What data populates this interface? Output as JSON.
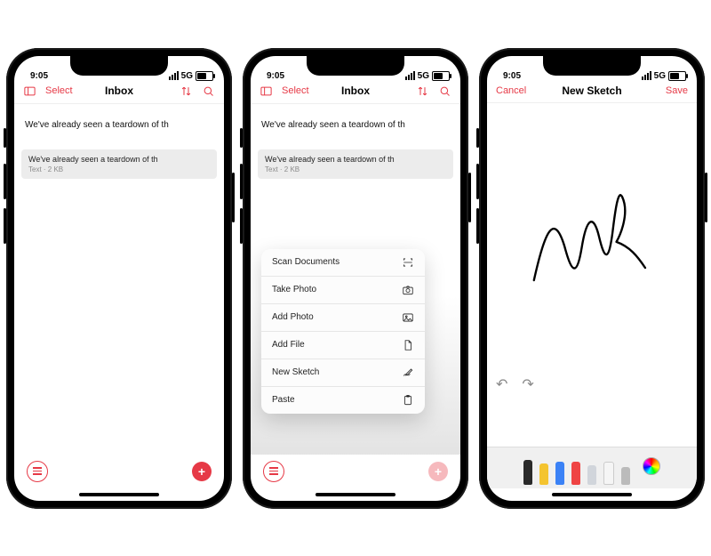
{
  "status": {
    "time": "9:05",
    "network": "5G",
    "battery_pct": 62
  },
  "phone1": {
    "nav": {
      "select": "Select",
      "title": "Inbox"
    },
    "note_preview": "We've already seen a teardown of th",
    "row": {
      "title": "We've already seen a teardown of th",
      "subtitle": "Text · 2 KB"
    }
  },
  "phone2": {
    "nav": {
      "select": "Select",
      "title": "Inbox"
    },
    "note_preview": "We've already seen a teardown of th",
    "row": {
      "title": "We've already seen a teardown of th",
      "subtitle": "Text · 2 KB"
    },
    "menu": [
      {
        "label": "Scan Documents",
        "icon": "scan"
      },
      {
        "label": "Take Photo",
        "icon": "camera"
      },
      {
        "label": "Add Photo",
        "icon": "image"
      },
      {
        "label": "Add File",
        "icon": "file"
      },
      {
        "label": "New Sketch",
        "icon": "sketch"
      },
      {
        "label": "Paste",
        "icon": "paste"
      }
    ]
  },
  "phone3": {
    "nav": {
      "cancel": "Cancel",
      "title": "New Sketch",
      "save": "Save"
    },
    "tools": [
      "pen",
      "highlighter",
      "marker-blue",
      "marker-red",
      "pencil",
      "eraser",
      "ruler"
    ]
  },
  "colors": {
    "accent": "#e63946"
  }
}
